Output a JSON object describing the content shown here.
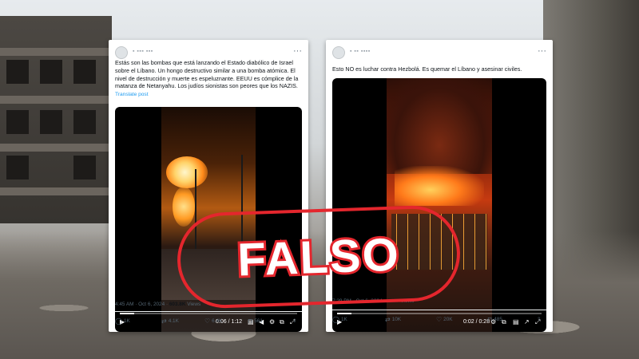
{
  "stamp": {
    "label": "FALSO",
    "color": "#e4262d"
  },
  "tweets": [
    {
      "text": "Estás son las bombas que está lanzando el Estado diabólico de Israel sobre el Líbano. Un hongo destructivo similar a una bomba atómica. El nivel de destrucción y muerte es espeluznante. EEUU es cómplice de la matanza de Netanyahu. Los judíos sionistas son peores que los NAZIS.",
      "translate": "Translate post",
      "video": {
        "time": "0:06 / 1:12",
        "progress": 0.08
      },
      "timestamp": "4:45 AM · Oct 6, 2024 · ",
      "views": "603.8K",
      "views_label": " Views",
      "actions": {
        "replies": "1K",
        "reposts": "4.1K",
        "likes": "6.4K",
        "bookmarks": "561"
      }
    },
    {
      "text": "Esto NO es luchar contra Hezbolá. Es quemar el Líbano y asesinar civiles.",
      "video": {
        "time": "0:02 / 0:28",
        "progress": 0.07
      },
      "timestamp": "7:29 PM · Oct 6, 2024 · ",
      "views": "429K",
      "views_label": " Views",
      "actions": {
        "replies": "1K",
        "reposts": "10K",
        "likes": "20K",
        "bookmarks": "485"
      }
    }
  ],
  "icons": {
    "more": "more-icon",
    "play": "play-icon",
    "captions": "captions-icon",
    "volume": "volume-icon",
    "settings": "settings-icon",
    "pip": "pip-icon",
    "share": "share-icon",
    "fullscreen": "fullscreen-icon",
    "reply": "reply-icon",
    "repost": "repost-icon",
    "like": "heart-icon",
    "bookmark": "bookmark-icon",
    "upload": "upload-icon"
  }
}
